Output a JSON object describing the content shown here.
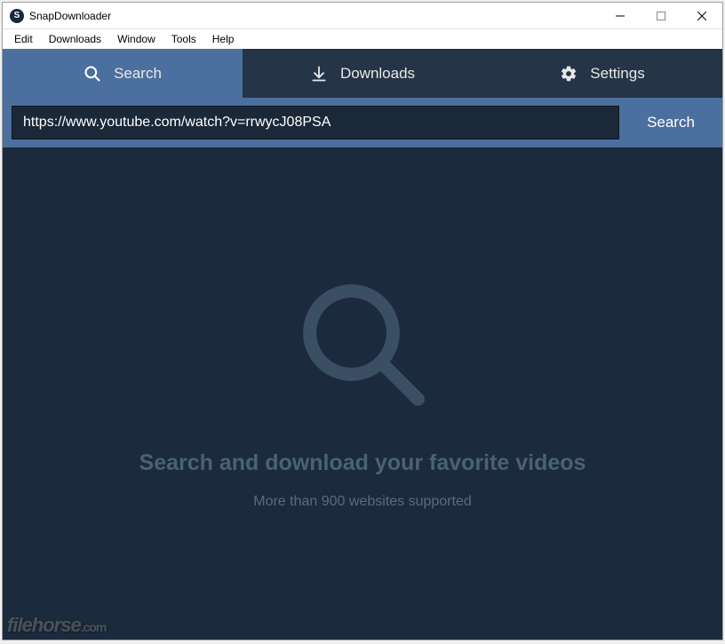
{
  "window": {
    "title": "SnapDownloader",
    "app_icon_letter": "S"
  },
  "menubar": {
    "items": [
      "Edit",
      "Downloads",
      "Window",
      "Tools",
      "Help"
    ]
  },
  "tabs": {
    "search": "Search",
    "downloads": "Downloads",
    "settings": "Settings"
  },
  "search": {
    "input_value": "https://www.youtube.com/watch?v=rrwycJ08PSA",
    "button_label": "Search"
  },
  "hero": {
    "title": "Search and download your favorite videos",
    "subtitle": "More than 900 websites supported"
  },
  "watermark": {
    "name": "filehorse",
    "ext": ".com"
  }
}
